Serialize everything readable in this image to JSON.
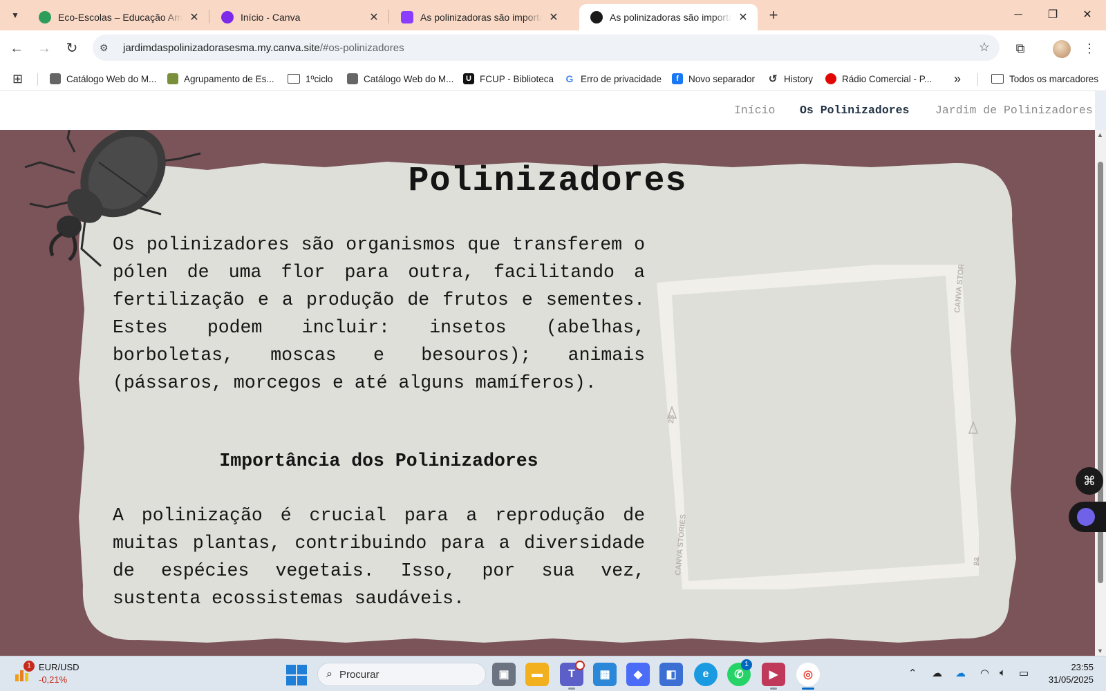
{
  "browser": {
    "tabs": [
      {
        "title": "Eco-Escolas – Educação Ambiental",
        "fav_color": "#2e9d5b",
        "active": false
      },
      {
        "title": "Início - Canva",
        "fav_color": "#7d2ae8",
        "active": false
      },
      {
        "title": "As polinizadoras são importantes",
        "fav_color": "#8b3dff",
        "active": false
      },
      {
        "title": "As polinizadoras são importantes",
        "fav_color": "#1a1a1a",
        "active": true
      }
    ],
    "tab_search_icon": "chevron-down-icon",
    "new_tab_icon": "plus-icon",
    "window_controls": {
      "minimize": "─",
      "restore": "❐",
      "close": "✕"
    },
    "url": {
      "host": "jardimdaspolinizadorasesma.my.canva.site",
      "path": "/#os-polinizadores"
    },
    "bookmarks": [
      {
        "label": "Catálogo Web do M...",
        "icon_color": "#555555",
        "icon_glyph": "◉"
      },
      {
        "label": "Agrupamento de Es...",
        "icon_color": "#7a8f3a",
        "icon_glyph": "▦"
      },
      {
        "label": "1ºciclo",
        "icon_color": "#ffffff",
        "icon_glyph": "🗀"
      },
      {
        "label": "Catálogo Web do M...",
        "icon_color": "#555555",
        "icon_glyph": "◉"
      },
      {
        "label": "FCUP - Biblioteca",
        "icon_color": "#111111",
        "icon_glyph": "U"
      },
      {
        "label": "Erro de privacidade",
        "icon_color": "#ffffff",
        "icon_glyph": "G"
      },
      {
        "label": "Novo separador",
        "icon_color": "#1877f2",
        "icon_glyph": "f"
      },
      {
        "label": "History",
        "icon_color": "#ffffff",
        "icon_glyph": "↺"
      },
      {
        "label": "Rádio Comercial - P...",
        "icon_color": "#e10600",
        "icon_glyph": "●"
      }
    ],
    "bookmarks_overflow": "»",
    "all_bookmarks_label": "Todos os marcadores"
  },
  "site": {
    "nav": [
      {
        "label": "Início",
        "active": false
      },
      {
        "label": "Os Polinizadores",
        "active": true
      },
      {
        "label": "Jardim de Polinizadores",
        "active": false
      }
    ],
    "title": "Polinizadores",
    "paragraph1": "Os polinizadores são organismos que transferem o pólen de uma flor para outra, facilitando a fertilização e a produção de frutos e sementes. Estes podem incluir: insetos (abelhas, borboletas, moscas e besouros); animais (pássaros, morcegos e até alguns mamíferos).",
    "subheading": "Importância dos Polinizadores",
    "paragraph2": "A polinização é crucial para a reprodução de muitas plantas, contribuindo para a diversidade de espécies vegetais. Isso, por sua vez, sustenta ecossistemas saudáveis.",
    "photo_frame": {
      "brand_text": "CANVA STORIES",
      "frame_number": "23"
    },
    "colors": {
      "page_bg": "#7b545a",
      "card_bg": "#dddfd8",
      "nav_active": "#223344"
    }
  },
  "taskbar": {
    "widget": {
      "pair": "EUR/USD",
      "change": "-0,21%",
      "badge": "1"
    },
    "search_placeholder": "Procurar",
    "apps": [
      {
        "name": "task-view",
        "color": "#5b6470",
        "glyph": "▣"
      },
      {
        "name": "file-explorer",
        "color": "#f2b01e",
        "glyph": "▬"
      },
      {
        "name": "teams",
        "color": "#5b5fc7",
        "glyph": "T"
      },
      {
        "name": "microsoft-store",
        "color": "#2b88d8",
        "glyph": "▦"
      },
      {
        "name": "copilot",
        "color": "#4a6cf7",
        "glyph": "◆"
      },
      {
        "name": "remote-app",
        "color": "#3b6fd4",
        "glyph": "◧"
      },
      {
        "name": "edge",
        "color": "#1a9ae0",
        "glyph": "e"
      },
      {
        "name": "whatsapp",
        "color": "#25d366",
        "glyph": "✆"
      },
      {
        "name": "canva-app",
        "color": "#f0f0f0",
        "glyph": "▶"
      },
      {
        "name": "chrome",
        "color": "#f0f0f0",
        "glyph": "◎"
      }
    ],
    "teams_badge": "",
    "whatsapp_badge": "1",
    "clock": {
      "time": "23:55",
      "date": "31/05/2025"
    }
  }
}
